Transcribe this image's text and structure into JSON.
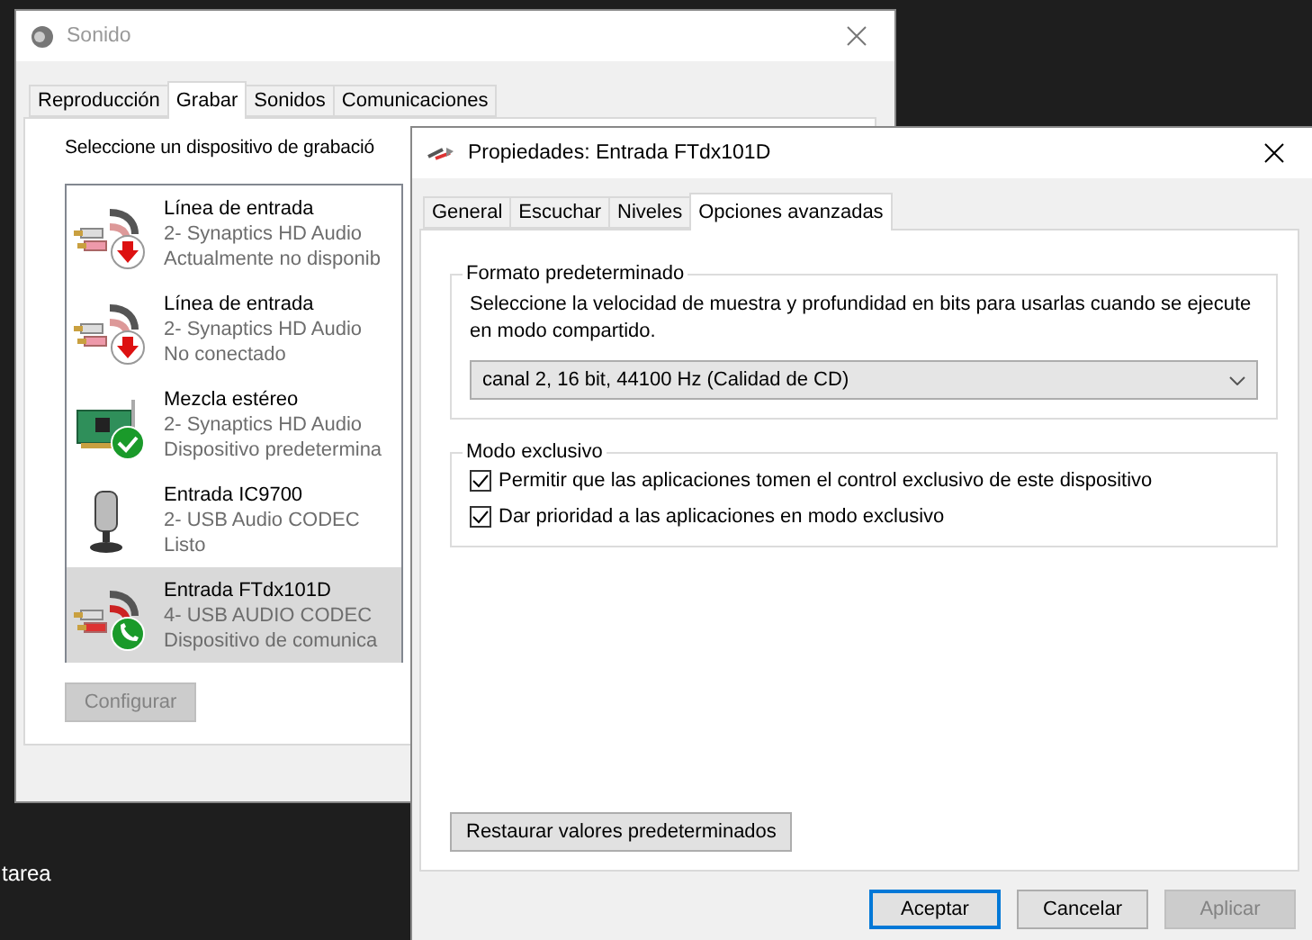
{
  "desktop": {
    "fragment": "tarea"
  },
  "sound_window": {
    "title": "Sonido",
    "tabs": [
      {
        "label": "Reproducción",
        "selected": false
      },
      {
        "label": "Grabar",
        "selected": true
      },
      {
        "label": "Sonidos",
        "selected": false
      },
      {
        "label": "Comunicaciones",
        "selected": false
      }
    ],
    "prompt": "Seleccione un dispositivo de grabació",
    "devices": [
      {
        "name": "Línea de entrada",
        "driver": "2- Synaptics HD Audio",
        "status": "Actualmente no disponib",
        "kind": "unavailable",
        "selected": false
      },
      {
        "name": "Línea de entrada",
        "driver": "2- Synaptics HD Audio",
        "status": "No conectado",
        "kind": "unplugged",
        "selected": false
      },
      {
        "name": "Mezcla estéreo",
        "driver": "2- Synaptics HD Audio",
        "status": "Dispositivo predetermina",
        "kind": "mixer",
        "selected": false
      },
      {
        "name": "Entrada IC9700",
        "driver": "2- USB Audio CODEC",
        "status": "Listo",
        "kind": "microphone",
        "selected": false
      },
      {
        "name": "Entrada FTdx101D",
        "driver": "4- USB AUDIO  CODEC",
        "status": "Dispositivo de comunica",
        "kind": "communication",
        "selected": true
      }
    ],
    "configure_button": {
      "label": "Configurar",
      "disabled": true
    }
  },
  "properties_window": {
    "title": "Propiedades: Entrada FTdx101D",
    "tabs": [
      {
        "label": "General",
        "selected": false
      },
      {
        "label": "Escuchar",
        "selected": false
      },
      {
        "label": "Niveles",
        "selected": false
      },
      {
        "label": "Opciones avanzadas",
        "selected": true
      }
    ],
    "default_format": {
      "heading": "Formato predeterminado",
      "description": "Seleccione la velocidad de muestra y profundidad en bits para usarlas cuando se ejecute en modo compartido.",
      "value": "canal 2, 16 bit, 44100 Hz (Calidad de CD)"
    },
    "exclusive_mode": {
      "heading": "Modo exclusivo",
      "options": [
        {
          "label": "Permitir que las aplicaciones tomen el control exclusivo de este dispositivo",
          "checked": true
        },
        {
          "label": "Dar prioridad a las aplicaciones en modo exclusivo",
          "checked": true
        }
      ]
    },
    "restore_button": "Restaurar valores predeterminados",
    "buttons": [
      {
        "label": "Aceptar",
        "kind": "default",
        "disabled": false
      },
      {
        "label": "Cancelar",
        "kind": "normal",
        "disabled": false
      },
      {
        "label": "Aplicar",
        "kind": "normal",
        "disabled": true
      }
    ]
  }
}
